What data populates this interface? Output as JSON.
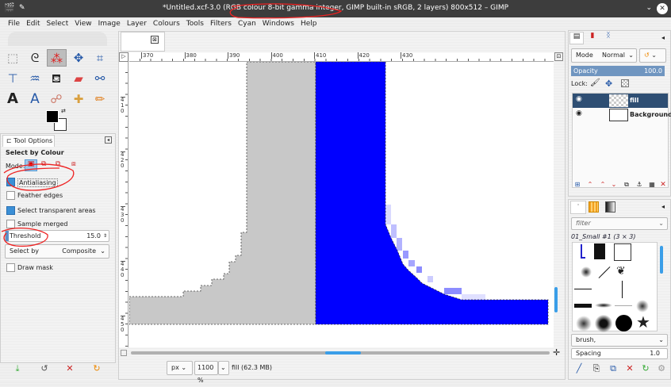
{
  "window": {
    "title": "*Untitled.xcf-3.0 (RGB colour 8-bit gamma integer, GIMP built-in sRGB, 2 layers) 800x512 – GIMP"
  },
  "menu": [
    "File",
    "Edit",
    "Select",
    "View",
    "Image",
    "Layer",
    "Colours",
    "Tools",
    "Filters",
    "Cyan",
    "Windows",
    "Help"
  ],
  "toolbox": {
    "tools": [
      "rect-select",
      "free-select",
      "select-by-colour",
      "move",
      "crop",
      "unified-transform",
      "warp",
      "bucket-fill",
      "eraser",
      "paths",
      "text",
      "measure",
      "smudge",
      "heal",
      "pencil"
    ],
    "active": "select-by-colour",
    "fg_color": "#000000",
    "bg_color": "#ffffff"
  },
  "tool_options": {
    "tab": "Tool Options",
    "title": "Select by Colour",
    "mode_label": "Mode:",
    "antialiasing": {
      "label": "Antialiasing",
      "checked": true
    },
    "feather": {
      "label": "Feather edges",
      "checked": false
    },
    "transparent": {
      "label": "Select transparent areas",
      "checked": true
    },
    "sample_merged": {
      "label": "Sample merged",
      "checked": false
    },
    "threshold": {
      "label": "Threshold",
      "value": "15.0"
    },
    "select_by": {
      "label": "Select by",
      "value": "Composite"
    },
    "draw_mask": {
      "label": "Draw mask",
      "checked": false
    }
  },
  "canvas": {
    "hruler": [
      "370",
      "380",
      "390",
      "400",
      "410",
      "420",
      "430"
    ],
    "vruler": [
      "410",
      "420",
      "430",
      "440",
      "450"
    ],
    "unit": "px",
    "zoom": "1100 %",
    "status": "fill (62.3 MB)",
    "colors": {
      "gray": "#c8c8c8",
      "blue": "#0000ff"
    }
  },
  "layers": {
    "mode_label": "Mode",
    "mode": "Normal",
    "opacity_label": "Opacity",
    "opacity": "100.0",
    "lock_label": "Lock:",
    "items": [
      {
        "name": "fill",
        "selected": true
      },
      {
        "name": "Background",
        "selected": false
      }
    ]
  },
  "brushes": {
    "filter_placeholder": "filter",
    "current": "01_Small #1 (3 × 3)",
    "tag": "brush,",
    "spacing_label": "Spacing",
    "spacing": "1.0"
  },
  "annotation_color": "#ee2222"
}
